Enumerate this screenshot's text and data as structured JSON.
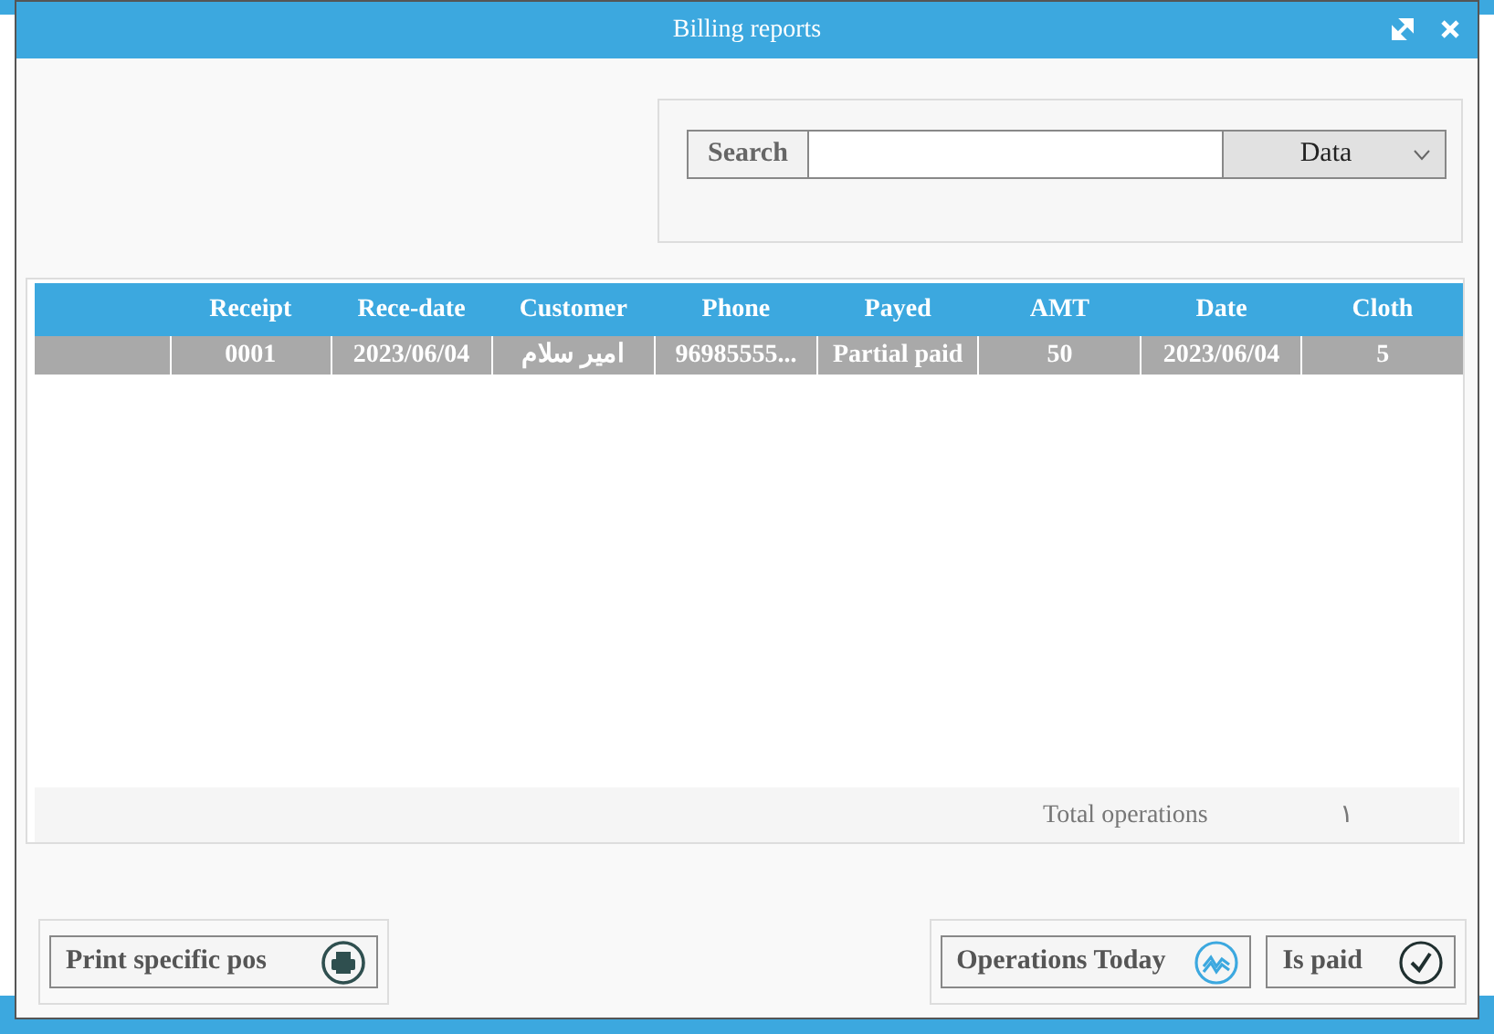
{
  "window": {
    "title": "Billing reports"
  },
  "search": {
    "label": "Search",
    "filter": "Data"
  },
  "table": {
    "columns": [
      "Receipt",
      "Rece-date",
      "Customer",
      "Phone",
      "Payed",
      "AMT",
      "Date",
      "Cloth"
    ],
    "rows": [
      {
        "selected": true,
        "cells": [
          "0001",
          "2023/06/04",
          "امير سلام",
          "96985555...",
          "Partial paid",
          "50",
          "2023/06/04",
          "5"
        ]
      }
    ]
  },
  "summary": {
    "label": "Total operations",
    "value": "١"
  },
  "buttons": [
    {
      "kind": "print",
      "label": "Print specific pos"
    },
    {
      "kind": "chart",
      "label": "Operations Today"
    },
    {
      "kind": "check",
      "label": "Is paid"
    }
  ]
}
